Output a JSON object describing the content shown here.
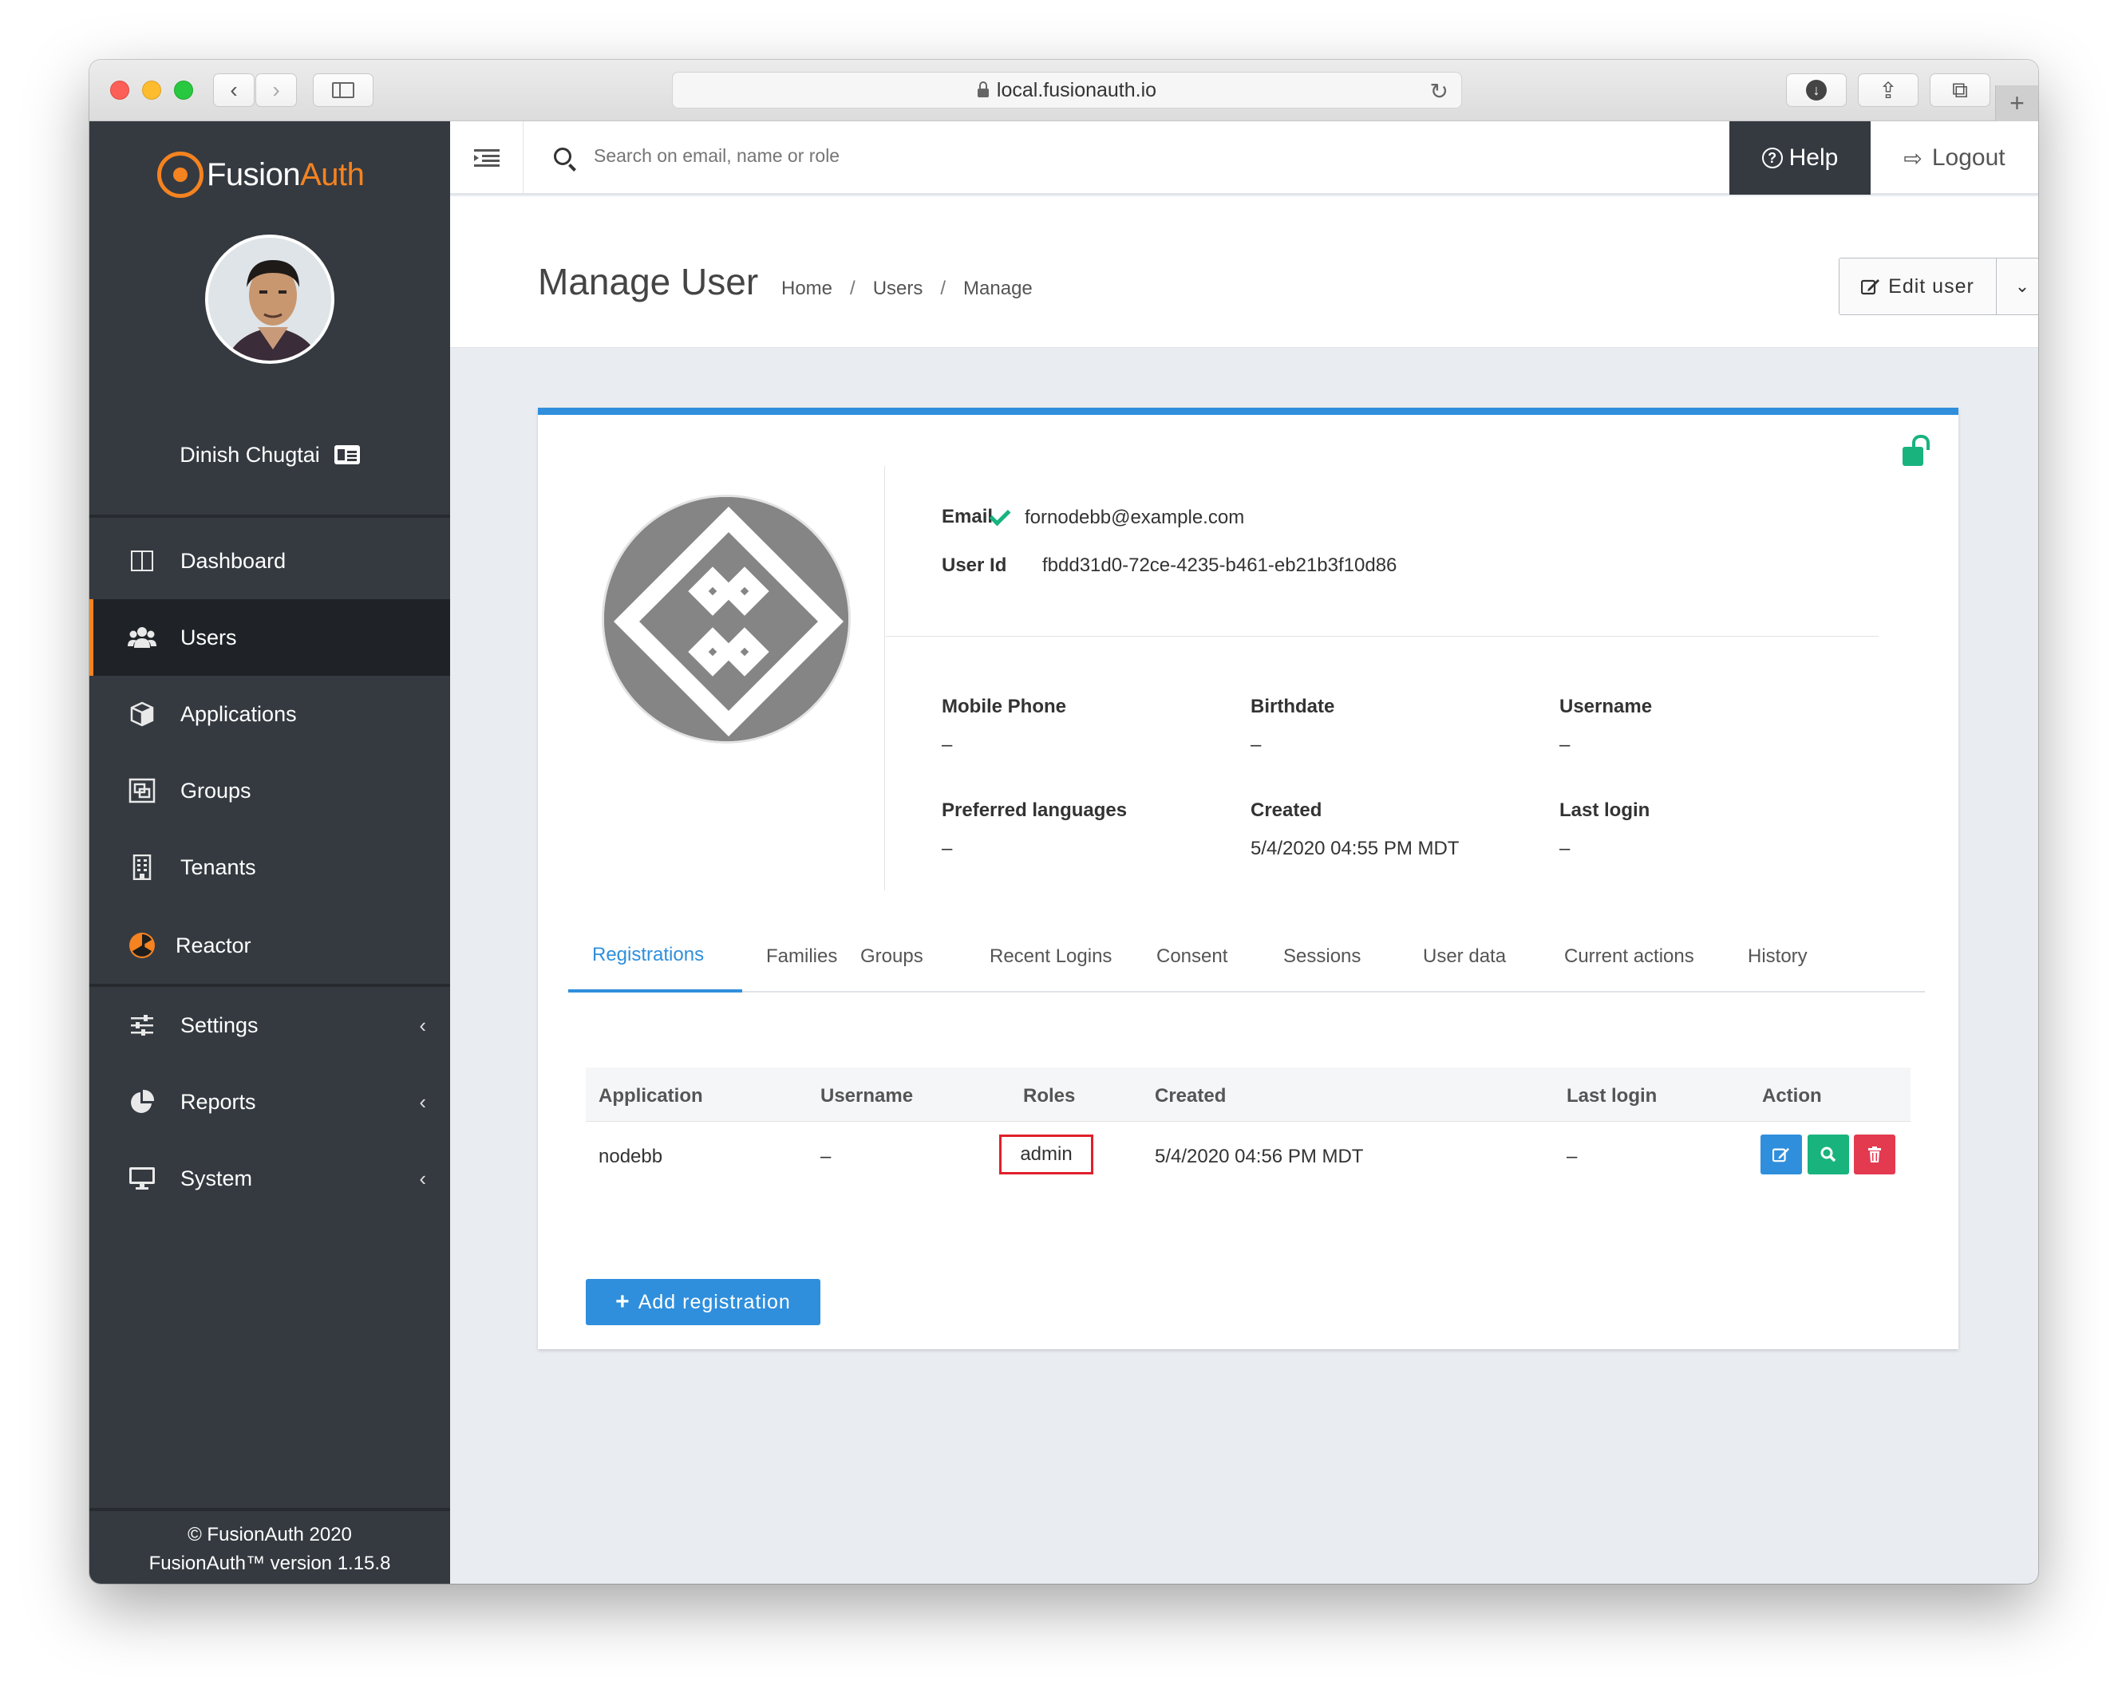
{
  "browser": {
    "url": "local.fusionauth.io"
  },
  "sidebar": {
    "logo_first": "Fusion",
    "logo_second": "Auth",
    "user_name": "Dinish Chugtai",
    "items": [
      {
        "label": "Dashboard",
        "icon": "columns-icon"
      },
      {
        "label": "Users",
        "icon": "users-icon",
        "active": true
      },
      {
        "label": "Applications",
        "icon": "cube-icon"
      },
      {
        "label": "Groups",
        "icon": "groups-icon"
      },
      {
        "label": "Tenants",
        "icon": "building-icon"
      },
      {
        "label": "Reactor",
        "icon": "radiation-icon"
      },
      {
        "label": "Settings",
        "icon": "sliders-icon"
      },
      {
        "label": "Reports",
        "icon": "pie-chart-icon"
      },
      {
        "label": "System",
        "icon": "monitor-icon"
      }
    ],
    "footer_line1": "© FusionAuth 2020",
    "footer_line2": "FusionAuth™ version 1.15.8"
  },
  "topbar": {
    "search_placeholder": "Search on email, name or role",
    "help_label": "Help",
    "logout_label": "Logout"
  },
  "header": {
    "title": "Manage User",
    "breadcrumb": [
      "Home",
      "Users",
      "Manage"
    ],
    "edit_label": "Edit user"
  },
  "user": {
    "email_label": "Email",
    "email": "fornodebb@example.com",
    "userid_label": "User Id",
    "userid": "fbdd31d0-72ce-4235-b461-eb21b3f10d86",
    "mobile_label": "Mobile Phone",
    "mobile": "–",
    "birthdate_label": "Birthdate",
    "birthdate": "–",
    "username_label": "Username",
    "username": "–",
    "languages_label": "Preferred languages",
    "languages": "–",
    "created_label": "Created",
    "created": "5/4/2020 04:55 PM MDT",
    "lastlogin_label": "Last login",
    "lastlogin": "–"
  },
  "tabs": [
    "Registrations",
    "Families",
    "Groups",
    "Recent Logins",
    "Consent",
    "Sessions",
    "User data",
    "Current actions",
    "History"
  ],
  "registrations": {
    "columns": [
      "Application",
      "Username",
      "Roles",
      "Created",
      "Last login",
      "Action"
    ],
    "rows": [
      {
        "application": "nodebb",
        "username": "–",
        "roles": "admin",
        "created": "5/4/2020 04:56 PM MDT",
        "last_login": "–"
      }
    ],
    "add_label": "Add registration"
  },
  "colors": {
    "accent_blue": "#2f8fdc",
    "brand_orange": "#f58320",
    "success_green": "#19b37e",
    "danger_red": "#e33a50",
    "sidebar_bg": "#353a41"
  }
}
